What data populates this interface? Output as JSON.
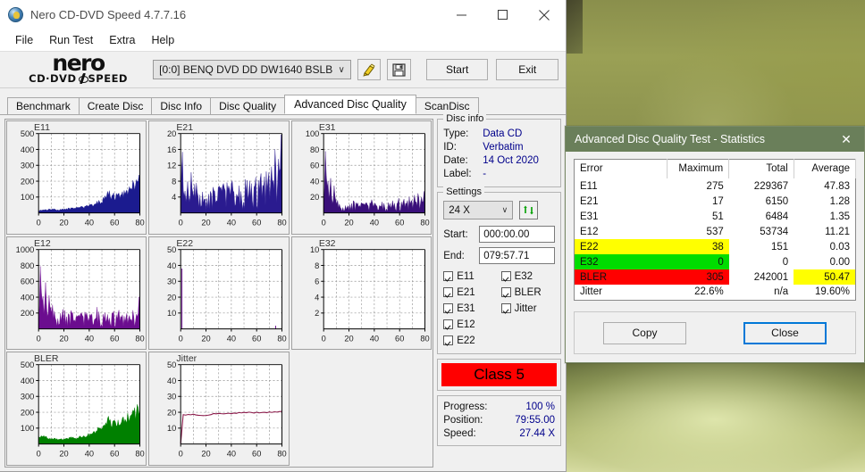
{
  "window": {
    "title": "Nero CD-DVD Speed 4.7.7.16",
    "minimize": "─",
    "maximize": "☐",
    "close": "✕"
  },
  "menu": [
    "File",
    "Run Test",
    "Extra",
    "Help"
  ],
  "logo": {
    "word": "nero",
    "left": "CD·DVD",
    "right": "SPEED"
  },
  "toolbar": {
    "drive": "[0:0]   BENQ DVD DD DW1640 BSLB",
    "drive_chevron": "∨",
    "eject_icon": "eject-icon",
    "save_icon": "floppy-save-icon",
    "start_label": "Start",
    "exit_label": "Exit"
  },
  "tabs": [
    {
      "label": "Benchmark",
      "active": false
    },
    {
      "label": "Create Disc",
      "active": false
    },
    {
      "label": "Disc Info",
      "active": false
    },
    {
      "label": "Disc Quality",
      "active": false
    },
    {
      "label": "Advanced Disc Quality",
      "active": true
    },
    {
      "label": "ScanDisc",
      "active": false
    }
  ],
  "disc_info": {
    "group_title": "Disc info",
    "rows": [
      {
        "label": "Type:",
        "value": "Data CD"
      },
      {
        "label": "ID:",
        "value": "Verbatim"
      },
      {
        "label": "Date:",
        "value": "14 Oct 2020"
      },
      {
        "label": "Label:",
        "value": "-"
      }
    ]
  },
  "settings": {
    "group_title": "Settings",
    "speed": "24 X",
    "speed_chevron": "∨",
    "refresh_icon": "refresh-icon",
    "start_label": "Start:",
    "start_value": "000:00.00",
    "end_label": "End:",
    "end_value": "079:57.71",
    "checks_left": [
      "E11",
      "E21",
      "E31",
      "E12",
      "E22"
    ],
    "checks_right": [
      "E32",
      "BLER",
      "Jitter"
    ]
  },
  "class": {
    "label": "Class 5",
    "color": "#ff0000"
  },
  "progress": [
    {
      "label": "Progress:",
      "value": "100 %"
    },
    {
      "label": "Position:",
      "value": "79:55.00"
    },
    {
      "label": "Speed:",
      "value": "27.44 X"
    }
  ],
  "dialog": {
    "title": "Advanced Disc Quality Test - Statistics",
    "close_glyph": "✕",
    "headers": [
      "Error",
      "Maximum",
      "Total",
      "Average"
    ],
    "rows": [
      {
        "error": "E11",
        "maximum": "275",
        "total": "229367",
        "average": "47.83",
        "highlight": "none"
      },
      {
        "error": "E21",
        "maximum": "17",
        "total": "6150",
        "average": "1.28",
        "highlight": "none"
      },
      {
        "error": "E31",
        "maximum": "51",
        "total": "6484",
        "average": "1.35",
        "highlight": "none"
      },
      {
        "error": "E12",
        "maximum": "537",
        "total": "53734",
        "average": "11.21",
        "highlight": "none"
      },
      {
        "error": "E22",
        "maximum": "38",
        "total": "151",
        "average": "0.03",
        "highlight": "yellow"
      },
      {
        "error": "E32",
        "maximum": "0",
        "total": "0",
        "average": "0.00",
        "highlight": "green"
      },
      {
        "error": "BLER",
        "maximum": "305",
        "total": "242001",
        "average": "50.47",
        "highlight": "red",
        "average_highlight": "yellow"
      },
      {
        "error": "Jitter",
        "maximum": "22.6%",
        "total": "n/a",
        "average": "19.60%",
        "highlight": "none"
      }
    ],
    "copy_label": "Copy",
    "close_label": "Close"
  },
  "chart_data": [
    {
      "type": "area",
      "title": "E11",
      "ylim": [
        0,
        500
      ],
      "xlim": [
        0,
        80
      ],
      "yticks": [
        100,
        200,
        300,
        400,
        500
      ],
      "xticks": [
        0,
        20,
        40,
        60,
        80
      ],
      "color": "#1b1b8f",
      "xlabel": "",
      "ylabel": "",
      "x": [
        0,
        2,
        4,
        6,
        8,
        10,
        12,
        14,
        16,
        18,
        20,
        22,
        24,
        26,
        28,
        30,
        32,
        34,
        36,
        38,
        40,
        42,
        44,
        46,
        48,
        50,
        52,
        54,
        56,
        58,
        60,
        62,
        64,
        66,
        68,
        70,
        72,
        74,
        76,
        78,
        80
      ],
      "values": [
        12,
        16,
        20,
        18,
        22,
        20,
        24,
        22,
        20,
        22,
        24,
        26,
        26,
        28,
        30,
        30,
        32,
        34,
        36,
        40,
        44,
        48,
        54,
        60,
        68,
        78,
        92,
        112,
        128,
        96,
        104,
        112,
        104,
        116,
        124,
        132,
        148,
        164,
        184,
        200,
        212
      ]
    },
    {
      "type": "area",
      "title": "E21",
      "ylim": [
        0,
        20
      ],
      "xlim": [
        0,
        80
      ],
      "yticks": [
        4,
        8,
        12,
        16,
        20
      ],
      "xticks": [
        0,
        20,
        40,
        60,
        80
      ],
      "color": "#2a1b8f",
      "xlabel": "",
      "ylabel": "",
      "x": [
        0,
        2,
        4,
        6,
        8,
        10,
        12,
        14,
        16,
        18,
        20,
        22,
        24,
        26,
        28,
        30,
        32,
        34,
        36,
        38,
        40,
        42,
        44,
        46,
        48,
        50,
        52,
        54,
        56,
        58,
        60,
        62,
        64,
        66,
        68,
        70,
        72,
        74,
        76,
        78,
        80
      ],
      "values": [
        13,
        6,
        4.5,
        5,
        6.5,
        4,
        5,
        8,
        4.5,
        3.5,
        2.5,
        4,
        3,
        4.5,
        3,
        4.5,
        5,
        4,
        5.5,
        4,
        5.5,
        3.5,
        4.5,
        4,
        3,
        5,
        6,
        5,
        5.5,
        4.5,
        5,
        6,
        6.5,
        6,
        7,
        7.5,
        8,
        9,
        10,
        11,
        14
      ]
    },
    {
      "type": "area",
      "title": "E31",
      "ylim": [
        0,
        100
      ],
      "xlim": [
        0,
        80
      ],
      "yticks": [
        20,
        40,
        60,
        80,
        100
      ],
      "xticks": [
        0,
        20,
        40,
        60,
        80
      ],
      "color": "#3a0f7a",
      "xlabel": "",
      "ylabel": "",
      "x": [
        0,
        2,
        4,
        6,
        8,
        10,
        12,
        14,
        16,
        18,
        20,
        22,
        24,
        26,
        28,
        30,
        32,
        34,
        36,
        38,
        40,
        42,
        44,
        46,
        48,
        50,
        52,
        54,
        56,
        58,
        60,
        62,
        64,
        66,
        68,
        70,
        72,
        74,
        76,
        78,
        80
      ],
      "values": [
        22,
        50,
        30,
        26,
        22,
        12,
        8,
        10,
        8,
        6,
        8,
        10,
        9,
        8,
        10,
        8,
        9,
        7,
        8,
        10,
        8,
        6,
        9,
        8,
        7,
        9,
        8,
        10,
        9,
        8,
        11,
        9,
        12,
        10,
        14,
        11,
        16,
        13,
        18,
        14,
        20
      ]
    },
    {
      "type": "area",
      "title": "E12",
      "ylim": [
        0,
        1000
      ],
      "xlim": [
        0,
        80
      ],
      "yticks": [
        200,
        400,
        600,
        800,
        1000
      ],
      "xticks": [
        0,
        20,
        40,
        60,
        80
      ],
      "color": "#6b0d8f",
      "xlabel": "",
      "ylabel": "",
      "x": [
        0,
        2,
        4,
        6,
        8,
        10,
        12,
        14,
        16,
        18,
        20,
        22,
        24,
        26,
        28,
        30,
        32,
        34,
        36,
        38,
        40,
        42,
        44,
        46,
        48,
        50,
        52,
        54,
        56,
        58,
        60,
        62,
        64,
        66,
        68,
        70,
        72,
        74,
        76,
        78,
        80
      ],
      "values": [
        160,
        537,
        300,
        380,
        260,
        220,
        160,
        200,
        150,
        140,
        230,
        130,
        110,
        160,
        120,
        100,
        140,
        110,
        150,
        120,
        100,
        130,
        110,
        160,
        120,
        90,
        150,
        120,
        100,
        140,
        110,
        130,
        160,
        120,
        100,
        150,
        110,
        140,
        120,
        160,
        320
      ]
    },
    {
      "type": "area",
      "title": "E22",
      "ylim": [
        0,
        50
      ],
      "xlim": [
        0,
        80
      ],
      "yticks": [
        10,
        20,
        30,
        40,
        50
      ],
      "xticks": [
        0,
        20,
        40,
        60,
        80
      ],
      "color": "#6b0d8f",
      "xlabel": "",
      "ylabel": "",
      "x": [
        1,
        75
      ],
      "values": [
        38,
        2
      ]
    },
    {
      "type": "area",
      "title": "E32",
      "ylim": [
        0,
        10
      ],
      "xlim": [
        0,
        80
      ],
      "yticks": [
        2,
        4,
        6,
        8,
        10
      ],
      "xticks": [
        0,
        20,
        40,
        60,
        80
      ],
      "color": "#6b0d8f",
      "xlabel": "",
      "ylabel": "",
      "x": [],
      "values": []
    },
    {
      "type": "area",
      "title": "BLER",
      "ylim": [
        0,
        500
      ],
      "xlim": [
        0,
        80
      ],
      "yticks": [
        100,
        200,
        300,
        400,
        500
      ],
      "xticks": [
        0,
        20,
        40,
        60,
        80
      ],
      "color": "#008000",
      "xlabel": "",
      "ylabel": "",
      "x": [
        0,
        2,
        4,
        6,
        8,
        10,
        12,
        14,
        16,
        18,
        20,
        22,
        24,
        26,
        28,
        30,
        32,
        34,
        36,
        38,
        40,
        42,
        44,
        46,
        48,
        50,
        52,
        54,
        56,
        58,
        60,
        62,
        64,
        66,
        68,
        70,
        72,
        74,
        76,
        78,
        80
      ],
      "values": [
        40,
        56,
        44,
        40,
        36,
        34,
        32,
        30,
        28,
        30,
        32,
        30,
        34,
        36,
        38,
        40,
        42,
        44,
        48,
        52,
        58,
        64,
        72,
        82,
        94,
        106,
        120,
        140,
        152,
        120,
        128,
        136,
        128,
        140,
        148,
        156,
        172,
        190,
        206,
        222,
        238
      ]
    },
    {
      "type": "line",
      "title": "Jitter",
      "ylim": [
        0,
        50
      ],
      "xlim": [
        0,
        80
      ],
      "yticks": [
        10,
        20,
        30,
        40,
        50
      ],
      "xticks": [
        0,
        20,
        40,
        60,
        80
      ],
      "color": "#8b1a4a",
      "xlabel": "",
      "ylabel": "",
      "x": [
        0,
        2,
        4,
        6,
        8,
        10,
        12,
        14,
        16,
        18,
        20,
        22,
        24,
        26,
        28,
        30,
        32,
        34,
        36,
        38,
        40,
        42,
        44,
        46,
        48,
        50,
        52,
        54,
        56,
        58,
        60,
        62,
        64,
        66,
        68,
        70,
        72,
        74,
        76,
        78,
        80
      ],
      "values": [
        0,
        18.5,
        18.2,
        18.6,
        18.4,
        18.8,
        18.3,
        18.1,
        18.0,
        17.9,
        18.0,
        18.2,
        18.5,
        19.2,
        19.0,
        19.3,
        19.1,
        19.0,
        19.2,
        19.4,
        19.1,
        19.5,
        19.3,
        19.8,
        19.6,
        19.9,
        19.7,
        20.1,
        19.8,
        19.5,
        20.0,
        19.6,
        19.8,
        20.0,
        19.7,
        20.2,
        19.9,
        20.3,
        20.1,
        20.4,
        20.6
      ]
    }
  ]
}
